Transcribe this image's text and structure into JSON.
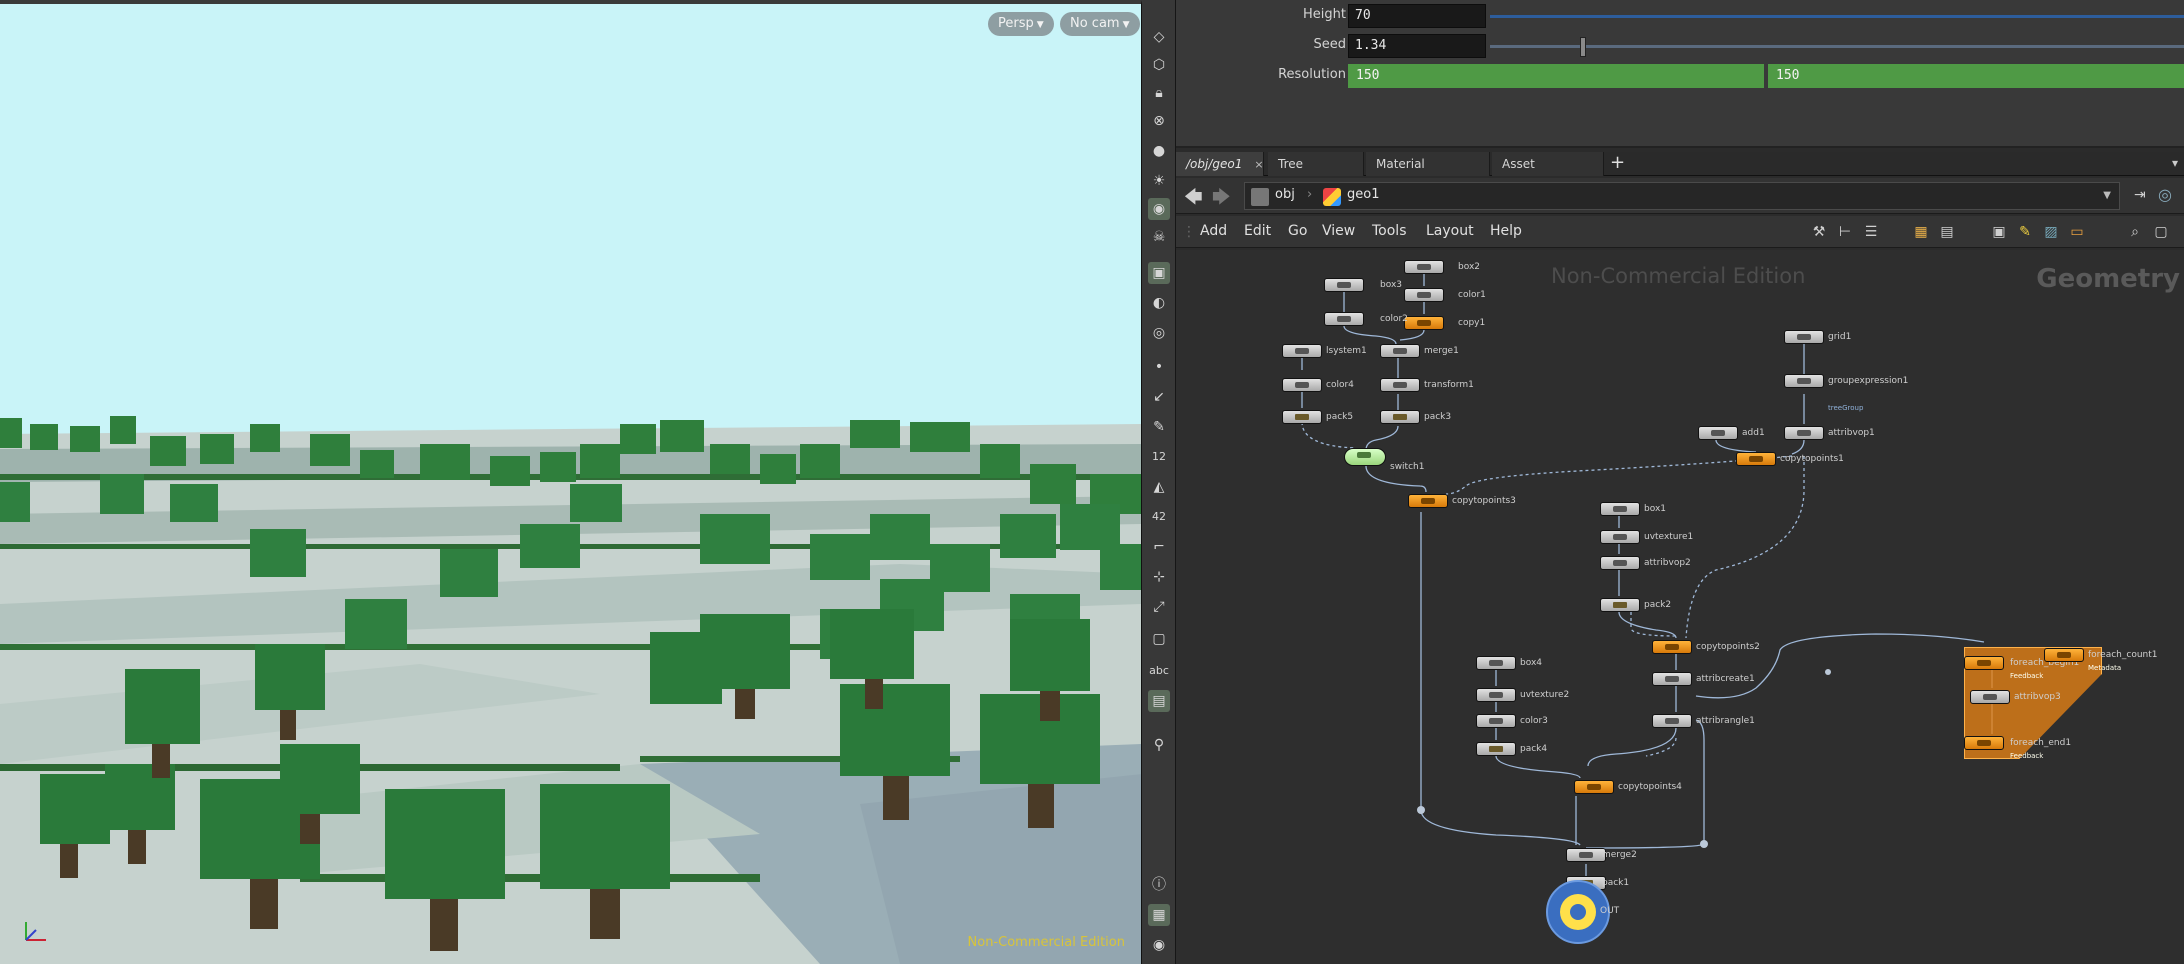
{
  "viewport": {
    "camera_view": "Persp",
    "camera": "No cam",
    "watermark": "Non-Commercial Edition",
    "colors": {
      "sky": "#c9f4f8",
      "grass": "#2e7a3a",
      "ground": "#c5d0cc",
      "water": "#9bb0b8"
    }
  },
  "toolbar": {
    "icons": [
      "view-icon",
      "select-icon",
      "lock-icon",
      "snap-icon",
      "sphere-icon",
      "light-icon",
      "camera-icon",
      "skull-icon",
      "display-icon",
      "visibility-icon",
      "render-icon",
      "point-icon",
      "brush-icon",
      "pen-icon",
      "number-icon",
      "bucket-icon",
      "normal-icon",
      "corner-icon",
      "transform-icon",
      "handle-icon",
      "square-icon",
      "abc-icon",
      "image-icon",
      "pin-icon",
      "info-icon",
      "grid-icon",
      "eye-icon"
    ],
    "number_label": "12",
    "number_label2": "42",
    "text_label": "abc"
  },
  "params": {
    "height_label": "Height",
    "height_value": "70",
    "seed_label": "Seed",
    "seed_value": "1.34",
    "resolution_label": "Resolution",
    "resolution_x": "150",
    "resolution_y": "150"
  },
  "tabs": [
    {
      "label": "/obj/geo1",
      "active": true
    },
    {
      "label": "Tree View"
    },
    {
      "label": "Material Palette"
    },
    {
      "label": "Asset Browser"
    }
  ],
  "path": {
    "root": "obj",
    "current": "geo1"
  },
  "menu": [
    "Add",
    "Edit",
    "Go",
    "View",
    "Tools",
    "Layout",
    "Help"
  ],
  "network": {
    "watermark": "Non-Commercial Edition",
    "context": "Geometry",
    "nodes": {
      "box2": "box2",
      "color1": "color1",
      "copy1": "copy1",
      "box3": "box3",
      "color2": "color2",
      "merge1": "merge1",
      "transform1": "transform1",
      "pack3": "pack3",
      "lsystem1": "lsystem1",
      "color4": "color4",
      "pack5": "pack5",
      "switch1": "switch1",
      "copytopoints3": "copytopoints3",
      "grid1": "grid1",
      "groupexpression1": "groupexpression1",
      "attribvop1": "attribvop1",
      "add1": "add1",
      "copytopoints1": "copytopoints1",
      "box1": "box1",
      "uvtexture1": "uvtexture1",
      "attribvop2": "attribvop2",
      "pack2": "pack2",
      "copytopoints2": "copytopoints2",
      "attribcreate1": "attribcreate1",
      "attribrangle1": "attribrangle1",
      "box4": "box4",
      "uvtexture2": "uvtexture2",
      "color3": "color3",
      "pack4": "pack4",
      "copytopoints4": "copytopoints4",
      "merge2": "merge2",
      "pack1": "pack1",
      "out": "OUT",
      "foreach_begin1": "foreach_begin1",
      "foreach_count1": "foreach_count1",
      "attribvop3": "attribvop3",
      "foreach_end1": "foreach_end1"
    },
    "sublabels": {
      "feedback": "Feedback",
      "metadata": "Metadata",
      "treegroup": "treeGroup"
    }
  }
}
